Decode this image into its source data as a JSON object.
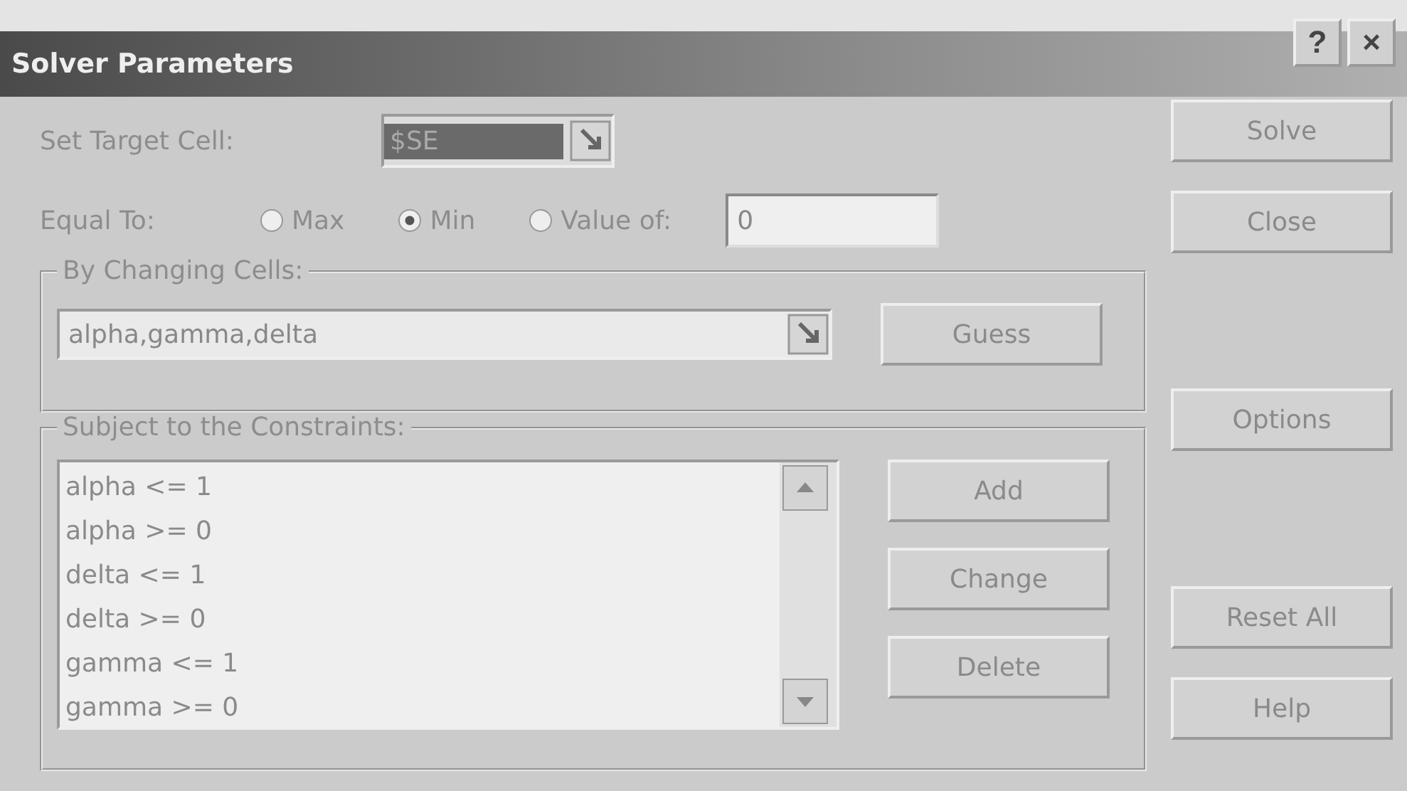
{
  "window": {
    "title": "Solver Parameters",
    "title_buttons": [
      "?",
      "×"
    ]
  },
  "target": {
    "label": "Set Target Cell:",
    "value": "$SE"
  },
  "equal_to": {
    "label": "Equal To:",
    "options": [
      {
        "label": "Max",
        "selected": false
      },
      {
        "label": "Min",
        "selected": true
      },
      {
        "label": "Value of:",
        "selected": false
      }
    ],
    "value": "0"
  },
  "changing": {
    "label": "By Changing Cells:",
    "value": "alpha,gamma,delta",
    "button": "Guess"
  },
  "constraints": {
    "label": "Subject to the Constraints:",
    "items": [
      "alpha <= 1",
      "alpha >= 0",
      "delta <= 1",
      "delta >= 0",
      "gamma <= 1",
      "gamma >= 0"
    ],
    "buttons": [
      "Add",
      "Change",
      "Delete"
    ]
  },
  "side_buttons": [
    [
      "Solve",
      "Close"
    ],
    [
      "Options"
    ],
    [
      "Reset All",
      "Help"
    ]
  ]
}
